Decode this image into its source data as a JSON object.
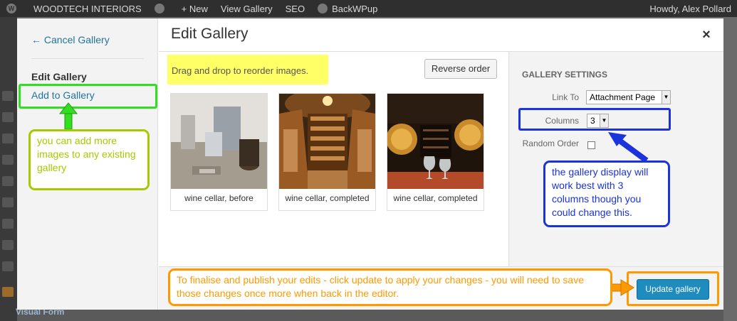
{
  "adminbar": {
    "site_name": "WOODTECH INTERIORS",
    "new_label": "+ New",
    "view_gallery": "View Gallery",
    "seo": "SEO",
    "backwpup": "BackWPup",
    "howdy": "Howdy, Alex Pollard"
  },
  "adminmenu": {
    "visual_form": "Visual Form"
  },
  "modal": {
    "menu": {
      "cancel": "← Cancel Gallery",
      "current": "Edit Gallery",
      "add": "Add to Gallery"
    },
    "title": "Edit Gallery",
    "close": "×",
    "drag_note": "Drag and drop to reorder images.",
    "reverse_order": "Reverse order",
    "images": [
      {
        "caption": "wine cellar, before"
      },
      {
        "caption": "wine cellar, completed"
      },
      {
        "caption": "wine cellar, completed"
      }
    ],
    "settings": {
      "heading": "GALLERY SETTINGS",
      "link_to_label": "Link To",
      "link_to_value": "Attachment Page",
      "columns_label": "Columns",
      "columns_value": "3",
      "random_order_label": "Random Order",
      "random_order_checked": false
    },
    "update_button": "Update gallery"
  },
  "annotations": {
    "add_note": "you can add more images to any existing gallery",
    "columns_note": "the gallery display will work best with 3 columns though you could change this.",
    "update_note": "To finalise and publish your edits - click update to apply your changes - you will need to save those changes once more when back in the editor."
  },
  "colors": {
    "annotation_green": "#33dd22",
    "annotation_lime": "#a8c800",
    "annotation_blue": "#1a33dd",
    "annotation_orange": "#ff9900",
    "highlight_yellow": "#ffff66",
    "primary_button": "#1e8cbe"
  }
}
